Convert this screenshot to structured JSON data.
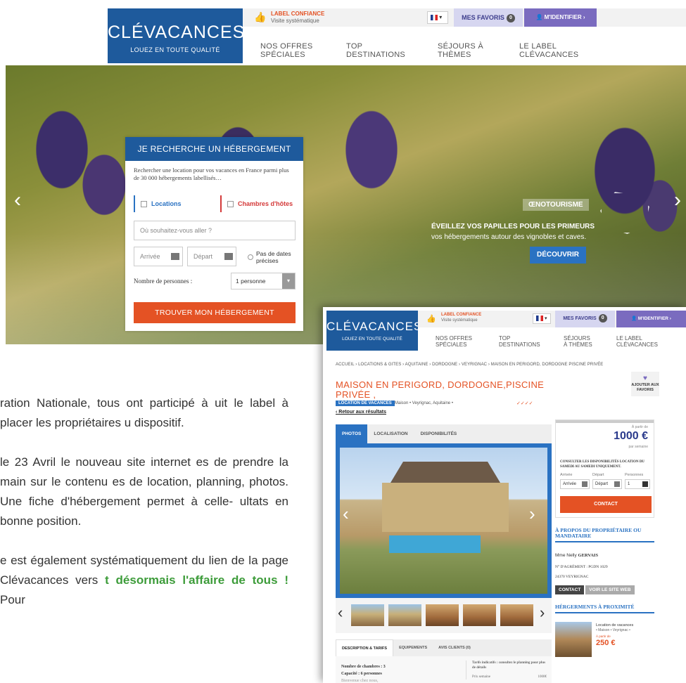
{
  "site": {
    "logo_name": "CLÉVACANCES",
    "logo_tagline": "LOUEZ EN TOUTE QUALITÉ",
    "label_line1": "LABEL CONFIANCE",
    "label_line2": "Visite systématique",
    "favorites_label": "MES FAVORIS",
    "favorites_count": "0",
    "login_label": "M'IDENTIFIER ›",
    "nav": [
      "NOS OFFRES SPÉCIALES",
      "TOP DESTINATIONS",
      "SÉJOURS À THÈMES",
      "LE LABEL CLÉVACANCES"
    ]
  },
  "hero": {
    "tag": "ŒNOTOURISME",
    "promo_line1": "ÉVEILLEZ VOS PAPILLES POUR LES PRIMEURS",
    "promo_line2": "vos hébergements autour des vignobles et caves.",
    "cta": "DÉCOUVRIR"
  },
  "search": {
    "title": "JE RECHERCHE UN HÉBERGEMENT",
    "intro": "Rechercher une location pour vos vacances en France parmi plus de 30 000 hébergements labellisés…",
    "opt_locations": "Locations",
    "opt_chambres": "Chambres d'hôtes",
    "where_placeholder": "Où souhaitez-vous aller ?",
    "arrival": "Arrivée",
    "departure": "Départ",
    "no_dates": "Pas de dates précises",
    "persons_label": "Nombre de personnes :",
    "persons_value": "1 personne",
    "submit": "TROUVER MON HÉBERGEMENT"
  },
  "article": {
    "p1": "ration Nationale, tous ont participé à uit le label à placer les propriétaires u dispositif.",
    "p2": "le 23 Avril le nouveau site internet es de prendre la main sur le contenu es de location, planning, photos. Une fiche d'hébergement permet à celle- ultats en bonne position.",
    "p3a": "e est également systématiquement du lien de la page Clévacances vers",
    "p3b": "t désormais l'affaire de tous !",
    "p3c": "Pour"
  },
  "listing": {
    "breadcrumb": "ACCUEIL › LOCATIONS & GITES › AQUITAINE › DORDOGNE › VEYRIGNAC › MAISON EN PERIGORD, DORDOGNE PISCINE PRIVÉE",
    "title": "MAISON EN PERIGORD, DORDOGNE,PISCINE PRIVÉE ,",
    "type_tag": "LOCATION DE VACANCES",
    "address": "Maison • Veyrignac, Aquitaine •",
    "back_link": "‹ Retour aux résultats",
    "add_fav": "AJOUTER AUX FAVORIS",
    "tabs": [
      "PHOTOS",
      "LOCALISATION",
      "DISPONIBILITÉS"
    ],
    "detail_tabs": [
      "DESCRIPTION & TARIFS",
      "EQUIPEMENTS",
      "AVIS CLIENTS (0)"
    ],
    "rooms": "Nombre de chambres : 3",
    "capacity": "Capacité : 6 personnes",
    "welcome": "Bienvenue chez nous,",
    "rates_note": "Tarifs indicatifs : consultez le planning pour plus de détails",
    "rates_row": "Prix semaine",
    "rates_row_value": "1000€"
  },
  "booking": {
    "from": "À partir de",
    "price": "1000 €",
    "per": "par semaine",
    "note": "CONSULTER LES DISPONIBILITÉS LOCATION DU SAMEDI AU SAMEDI UNIQUEMENT.",
    "arrival_label": "Arrivée",
    "departure_label": "Départ",
    "persons_label": "Personnes",
    "arrival": "Arrivée",
    "departure": "Départ",
    "persons": "1",
    "contact": "CONTACT"
  },
  "owner": {
    "heading": "À PROPOS DU PROPRIÉTAIRE OU MANDATAIRE",
    "name_prefix": "Mme Nelly",
    "name_last": "GERVAIS",
    "agrement": "N° D'AGRÉMENT : PGDN 1029",
    "town": "24370 VEYRIGNAC",
    "contact_btn": "CONTACT",
    "website_btn": "VOIR LE SITE WEB"
  },
  "nearby": {
    "heading": "HÉRGERMENTS À PROXIMITÉ",
    "title": "Location de vacances",
    "sub": "• Maison • Veyrignac •",
    "from": "À partir de",
    "price": "250 €"
  }
}
